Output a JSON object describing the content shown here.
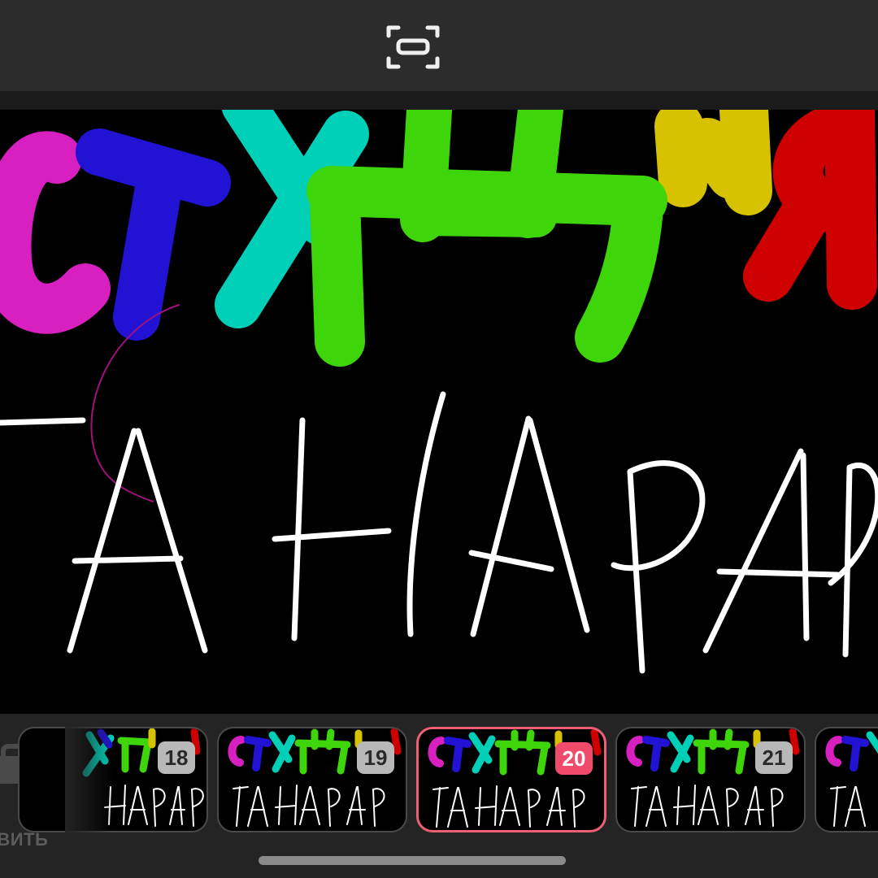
{
  "toolbar": {
    "fullscreen_icon": "fullscreen-toggle-icon"
  },
  "canvas": {
    "top_text": "СТХДИЯ",
    "bottom_text": "ГАНАРАР"
  },
  "timeline": {
    "add_label": "АВИТЬ",
    "frames": [
      {
        "number": "18",
        "selected": false
      },
      {
        "number": "19",
        "selected": false
      },
      {
        "number": "20",
        "selected": true
      },
      {
        "number": "21",
        "selected": false
      },
      {
        "number": "",
        "selected": false
      }
    ]
  },
  "colors": {
    "selected_accent": "#f24a6a",
    "magenta": "#d81fbf",
    "blue": "#2213d4",
    "teal": "#00d0b8",
    "green": "#3ed50a",
    "yellow": "#d6c200",
    "red": "#cf0000"
  }
}
